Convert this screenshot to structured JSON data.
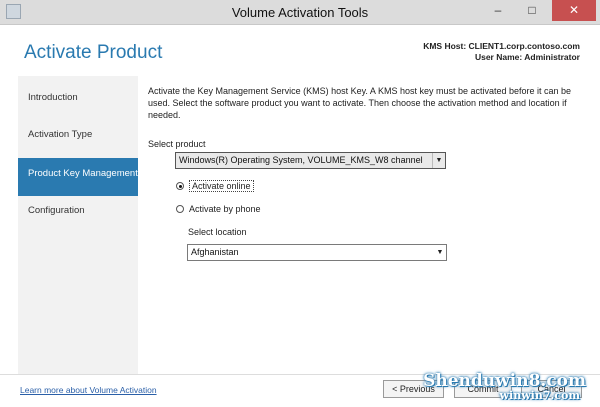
{
  "window": {
    "title": "Volume Activation Tools",
    "minimize": "–",
    "maximize": "□",
    "close": "✕"
  },
  "header": {
    "page_title": "Activate Product",
    "kms_host_label": "KMS Host: CLIENT1.corp.contoso.com",
    "user_name_label": "User Name: Administrator"
  },
  "sidebar": {
    "items": [
      {
        "label": "Introduction",
        "active": false
      },
      {
        "label": "Activation Type",
        "active": false
      },
      {
        "label": "Product Key Management",
        "active": true
      },
      {
        "label": "Configuration",
        "active": false
      }
    ]
  },
  "main": {
    "description": "Activate the Key Management Service (KMS) host Key. A KMS host key must be activated before it can be used. Select the software product you want to activate. Then choose the activation method and location if needed.",
    "select_product_label": "Select product",
    "selected_product": "Windows(R) Operating System, VOLUME_KMS_W8 channel",
    "options": {
      "activate_online": "Activate online",
      "activate_by_phone": "Activate by phone",
      "selected": "activate_online"
    },
    "select_location_label": "Select location",
    "selected_location": "Afghanistan"
  },
  "footer": {
    "learn_more_link": "Learn more about Volume Activation",
    "previous_button": "< Previous",
    "next_button": "Commit",
    "cancel_button": "Cancel"
  },
  "watermark": {
    "line1": "Shenduwin8.com",
    "line2": "winwin7.com"
  },
  "colors": {
    "accent": "#2a7ab0",
    "close_button": "#c75050"
  }
}
